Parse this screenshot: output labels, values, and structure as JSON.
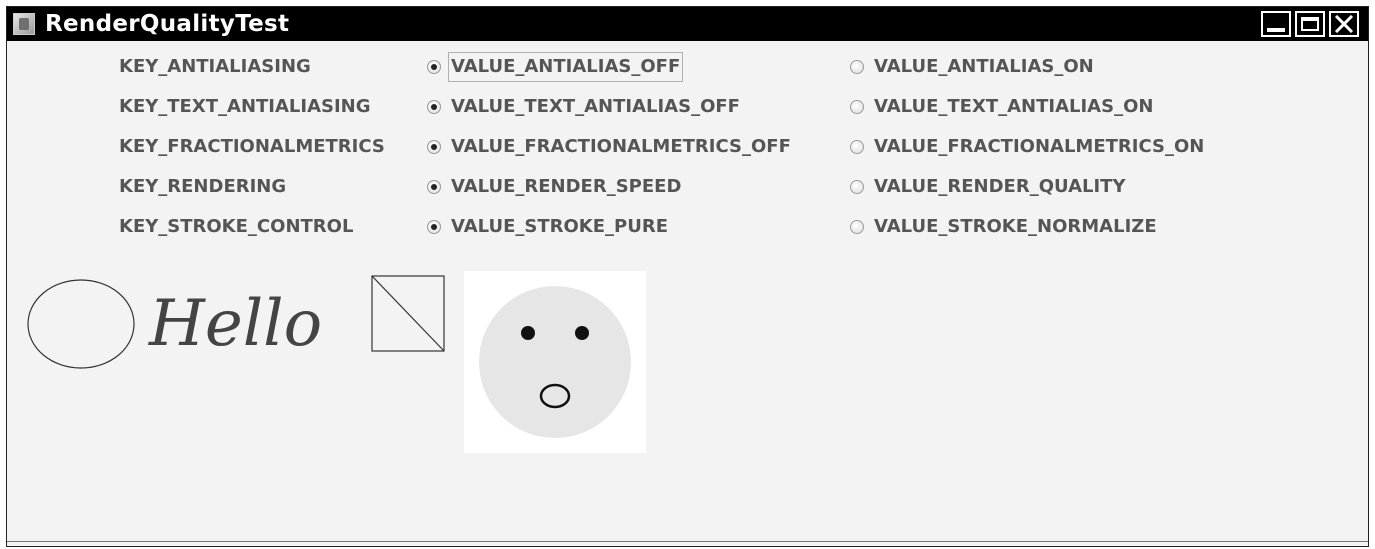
{
  "window": {
    "title": "RenderQualityTest"
  },
  "hints": [
    {
      "key": "KEY_ANTIALIASING",
      "option_off": "VALUE_ANTIALIAS_OFF",
      "option_on": "VALUE_ANTIALIAS_ON",
      "selected": "off"
    },
    {
      "key": "KEY_TEXT_ANTIALIASING",
      "option_off": "VALUE_TEXT_ANTIALIAS_OFF",
      "option_on": "VALUE_TEXT_ANTIALIAS_ON",
      "selected": "off"
    },
    {
      "key": "KEY_FRACTIONALMETRICS",
      "option_off": "VALUE_FRACTIONALMETRICS_OFF",
      "option_on": "VALUE_FRACTIONALMETRICS_ON",
      "selected": "off"
    },
    {
      "key": "KEY_RENDERING",
      "option_off": "VALUE_RENDER_SPEED",
      "option_on": "VALUE_RENDER_QUALITY",
      "selected": "off"
    },
    {
      "key": "KEY_STROKE_CONTROL",
      "option_off": "VALUE_STROKE_PURE",
      "option_on": "VALUE_STROKE_NORMALIZE",
      "selected": "off"
    }
  ],
  "canvas": {
    "text": "Hello",
    "image_icon": "smiley-face-icon"
  },
  "colors": {
    "titlebar": "#000000",
    "window_bg": "#f3f3f3",
    "label_text": "#555555",
    "smiley_face": "#e6e6e6"
  }
}
